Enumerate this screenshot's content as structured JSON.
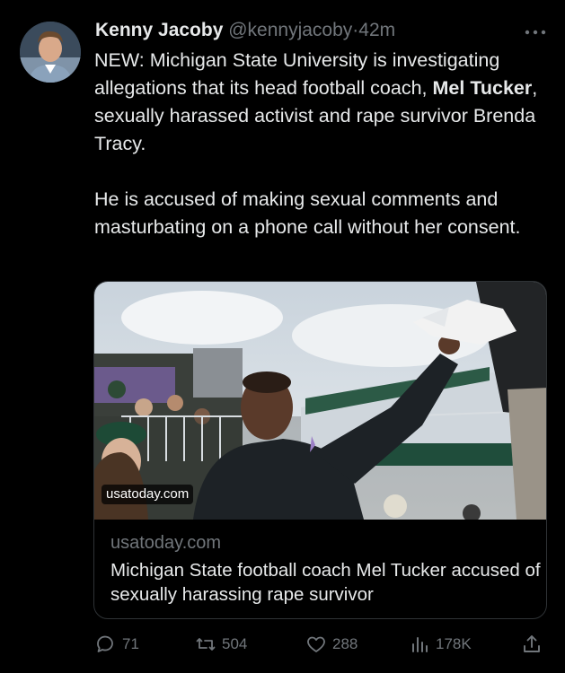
{
  "tweet": {
    "author_name": "Kenny Jacoby",
    "author_handle": "@kennyjacoby",
    "separator": "·",
    "time": "42m",
    "text_part1_pre": "NEW: Michigan State University is investigating allegations that its head football coach, ",
    "text_part1_bold": "Mel Tucker",
    "text_part1_post": ", sexually harassed activist and rape survivor Brenda Tracy.",
    "text_part2": "He is accused of making sexual comments and masturbating on a phone call without her consent."
  },
  "card": {
    "image_domain_label": "usatoday.com",
    "domain": "usatoday.com",
    "title": "Michigan State football coach Mel Tucker accused of sexually harassing rape survivor"
  },
  "actions": {
    "replies": "71",
    "retweets": "504",
    "likes": "288",
    "views": "178K"
  },
  "icons": {
    "more": "more-dots-icon",
    "reply": "reply-icon",
    "retweet": "retweet-icon",
    "like": "heart-icon",
    "views": "analytics-bars-icon",
    "share": "share-icon"
  },
  "colors": {
    "background": "#000000",
    "text_primary": "#e7e9ea",
    "text_secondary": "#71767b",
    "border": "#2f3336"
  }
}
